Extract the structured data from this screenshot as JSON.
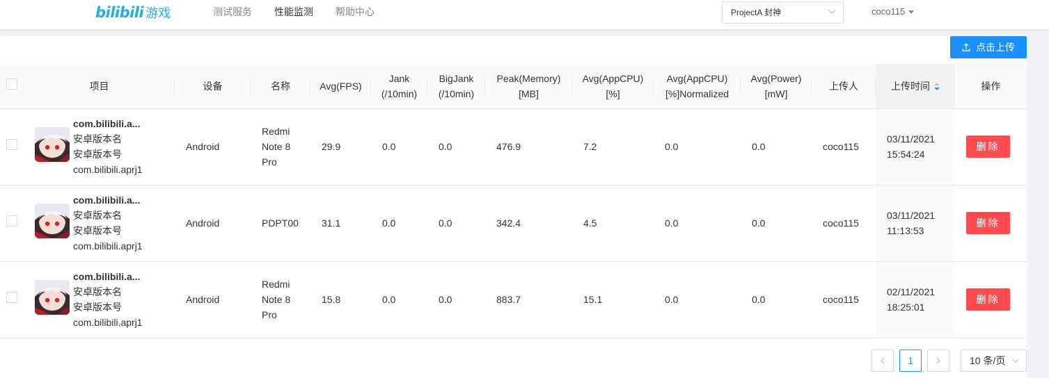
{
  "header": {
    "logo_brand": "bilibili",
    "logo_sub": "游戏",
    "nav": [
      "测试服务",
      "性能监测",
      "帮助中心"
    ],
    "active_nav": 1,
    "project_select": "ProjectA 封神",
    "user": "coco115"
  },
  "toolbar": {
    "upload_label": "点击上传"
  },
  "table": {
    "columns": [
      "项目",
      "设备",
      "名称",
      "Avg(FPS)",
      "Jank\n(/10min)",
      "BigJank\n(/10min)",
      "Peak(Memory)\n[MB]",
      "Avg(AppCPU)\n[%]",
      "Avg(AppCPU)\n[%]Normalized",
      "Avg(Power)\n[mW]",
      "上传人",
      "上传时间",
      "操作"
    ],
    "rows": [
      {
        "item_title": "com.bilibili.a...",
        "item_line2": "安卓版本名",
        "item_line3": "安卓版本号",
        "item_line4": "com.bilibili.aprj1",
        "device": "Android",
        "name": "Redmi\nNote 8\nPro",
        "fps": "29.9",
        "jank": "0.0",
        "bigjank": "0.0",
        "memory": "476.9",
        "cpu": "7.2",
        "cpu_norm": "0.0",
        "power": "0.0",
        "uploader": "coco115",
        "time": "03/11/2021\n15:54:24",
        "action": "删除"
      },
      {
        "item_title": "com.bilibili.a...",
        "item_line2": "安卓版本名",
        "item_line3": "安卓版本号",
        "item_line4": "com.bilibili.aprj1",
        "device": "Android",
        "name": "PDPT00",
        "fps": "31.1",
        "jank": "0.0",
        "bigjank": "0.0",
        "memory": "342.4",
        "cpu": "4.5",
        "cpu_norm": "0.0",
        "power": "0.0",
        "uploader": "coco115",
        "time": "03/11/2021\n11:13:53",
        "action": "删除"
      },
      {
        "item_title": "com.bilibili.a...",
        "item_line2": "安卓版本名",
        "item_line3": "安卓版本号",
        "item_line4": "com.bilibili.aprj1",
        "device": "Android",
        "name": "Redmi\nNote 8\nPro",
        "fps": "15.8",
        "jank": "0.0",
        "bigjank": "0.0",
        "memory": "883.7",
        "cpu": "15.1",
        "cpu_norm": "0.0",
        "power": "0.0",
        "uploader": "coco115",
        "time": "02/11/2021\n18:25:01",
        "action": "删除"
      }
    ]
  },
  "pagination": {
    "current_page": "1",
    "page_size": "10 条/页"
  },
  "colors": {
    "primary": "#1890ff",
    "danger": "#ff4d4f",
    "brand": "#23ade5"
  }
}
